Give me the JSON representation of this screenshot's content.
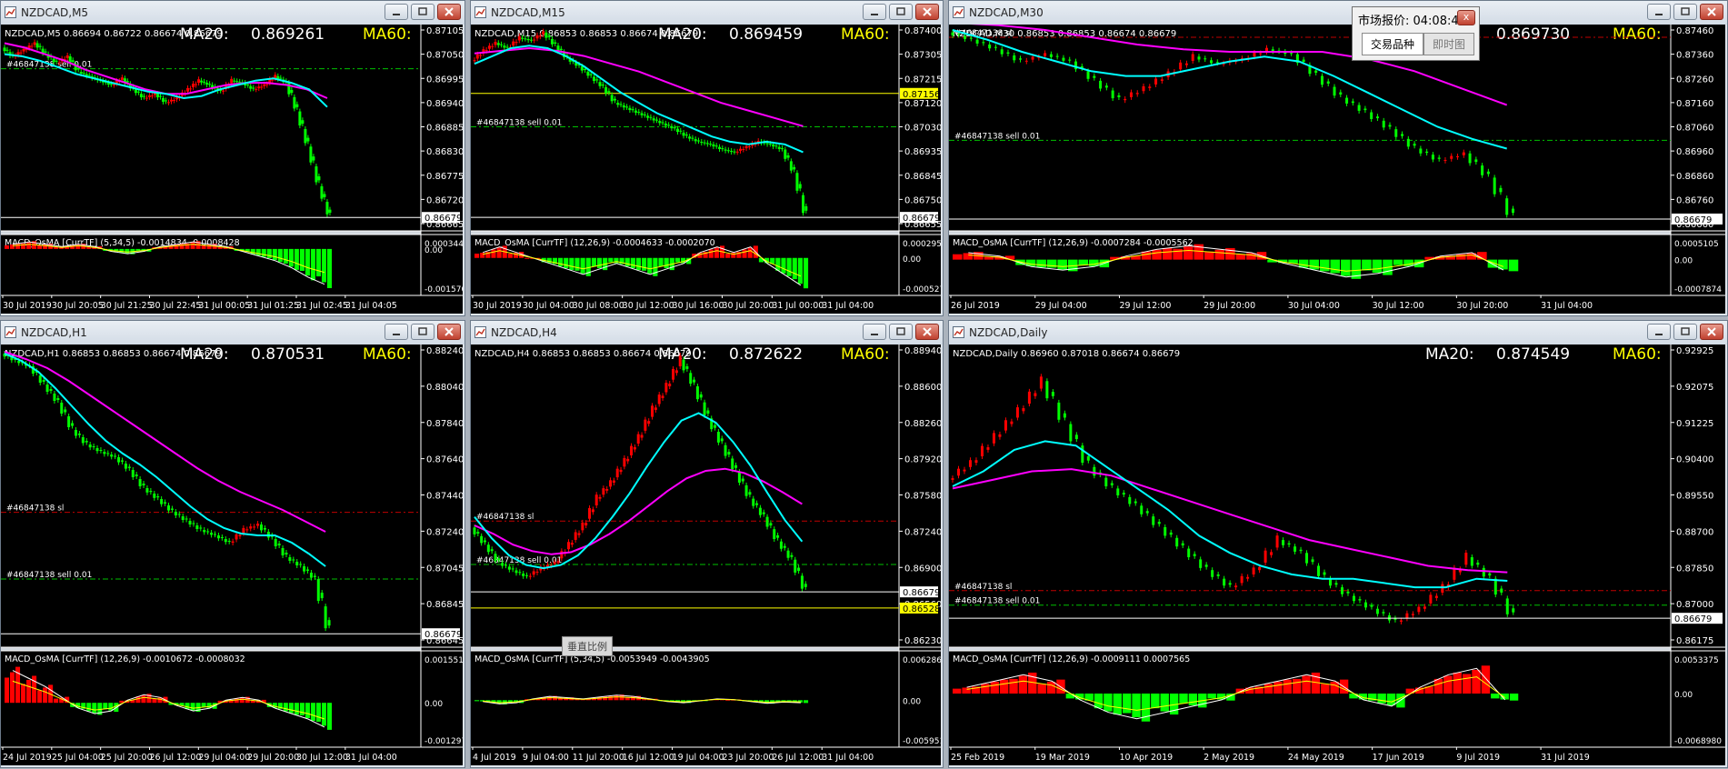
{
  "colors": {
    "up_candle": "#ff0000",
    "down_candle": "#00ff00",
    "ma20_line": "#00ffff",
    "ma60_line": "#ff00ff",
    "ma20_label": "#ffffff",
    "ma60_label": "#ffff00",
    "sell_line": "#00c000",
    "sl_line": "#c00000",
    "bid_line": "#ffffff",
    "ask_line": "#ffff00",
    "chart_bg": "#000000"
  },
  "icons": {
    "window": "chart-window-icon",
    "minimize": "minimize-icon",
    "restore": "restore-icon",
    "close": "close-icon"
  },
  "windows": [
    {
      "title": "NZDCAD,M5",
      "info": "NZDCAD,M5  0.86694 0.86722 0.86674 0.86679",
      "ma20_label": "MA20:",
      "ma20_value": "0.869261",
      "ma60_label": "MA60:",
      "price_labels": [
        "0.87105",
        "0.87050",
        "0.86995",
        "0.86940",
        "0.86885",
        "0.86830",
        "0.86775",
        "0.86720",
        "0.86665"
      ],
      "current_price": "0.86679",
      "marker_label": "",
      "orders": [
        {
          "text": "#46847138 sell 0.01",
          "type": "sell"
        }
      ],
      "macd_header": "MACD_OsMA [CurrTF] (5,34,5) -0.0014834 -0.0008428",
      "macd_axis": [
        "0.0003441",
        "0.00",
        "-0.0015704"
      ],
      "time_labels": [
        "30 Jul 2019",
        "30 Jul 20:05",
        "30 Jul 21:25",
        "30 Jul 22:45",
        "31 Jul 00:05",
        "31 Jul 01:25",
        "31 Jul 02:45",
        "31 Jul 04:05"
      ],
      "price_series": [
        0.87065,
        0.87045,
        0.8706,
        0.87075,
        0.8705,
        0.8703,
        0.87045,
        0.8701,
        0.87,
        0.8699,
        0.8698,
        0.86995,
        0.8697,
        0.8695,
        0.8696,
        0.8694,
        0.8695,
        0.8697,
        0.8699,
        0.8698,
        0.86965,
        0.8699,
        0.86985,
        0.8697,
        0.8698,
        0.87,
        0.86985,
        0.8692,
        0.8684,
        0.8675,
        0.86679
      ],
      "ma20_series": [
        0.8705,
        0.87045,
        0.87035,
        0.8702,
        0.87005,
        0.86995,
        0.86985,
        0.86975,
        0.86965,
        0.8696,
        0.8695,
        0.86955,
        0.8697,
        0.8698,
        0.8699,
        0.86995,
        0.86985,
        0.8697,
        0.8693
      ],
      "ma60_series": [
        0.87075,
        0.87065,
        0.8705,
        0.87035,
        0.87015,
        0.87,
        0.86985,
        0.8697,
        0.8696,
        0.8696,
        0.8697,
        0.8698,
        0.86985,
        0.86985,
        0.8698,
        0.8697,
        0.8695
      ],
      "macd_hist": [
        0.0002,
        0.0003,
        0.0002,
        0.0001,
        0.0002,
        0.0001,
        -0.0001,
        -0.0002,
        -0.0001,
        0.0001,
        0.0002,
        0.0003,
        0.0002,
        0.0001,
        -0.0001,
        -0.0003,
        -0.0005,
        -0.0008,
        -0.0012,
        -0.0015
      ]
    },
    {
      "title": "NZDCAD,M15",
      "info": "NZDCAD,M15  0.86853 0.86853 0.86674 0.86679",
      "ma20_label": "MA20:",
      "ma20_value": "0.869459",
      "ma60_label": "MA60:",
      "price_labels": [
        "0.87400",
        "0.87305",
        "0.87215",
        "0.87120",
        "0.87030",
        "0.86935",
        "0.86845",
        "0.86750",
        "0.86655"
      ],
      "current_price": "0.86679",
      "marker_label": "0.87156",
      "orders": [
        {
          "text": "#46847138 sell 0.01",
          "type": "sell"
        }
      ],
      "macd_header": "MACD_OsMA [CurrTF] (12,26,9) -0.0004633 -0.0002070",
      "macd_axis": [
        "0.0002953",
        "0.00",
        "-0.0005270"
      ],
      "time_labels": [
        "30 Jul 2019",
        "30 Jul 04:00",
        "30 Jul 08:00",
        "30 Jul 12:00",
        "30 Jul 16:00",
        "30 Jul 20:00",
        "31 Jul 00:00",
        "31 Jul 04:00"
      ],
      "price_series": [
        0.8728,
        0.8732,
        0.8735,
        0.8733,
        0.8737,
        0.8736,
        0.8739,
        0.8734,
        0.8729,
        0.8726,
        0.8722,
        0.8718,
        0.8712,
        0.871,
        0.8708,
        0.8706,
        0.8704,
        0.8702,
        0.8699,
        0.8697,
        0.8696,
        0.8694,
        0.8693,
        0.8695,
        0.8697,
        0.8696,
        0.8694,
        0.8685,
        0.86679
      ],
      "ma20_series": [
        0.8727,
        0.873,
        0.8733,
        0.8734,
        0.8733,
        0.873,
        0.8726,
        0.8721,
        0.8716,
        0.8712,
        0.8708,
        0.8705,
        0.8702,
        0.8699,
        0.8697,
        0.8696,
        0.8697,
        0.8696,
        0.8693
      ],
      "ma60_series": [
        0.8731,
        0.8732,
        0.8733,
        0.8732,
        0.873,
        0.8727,
        0.8724,
        0.872,
        0.8716,
        0.8712,
        0.8709,
        0.8706,
        0.8703
      ],
      "macd_hist": [
        0.0001,
        0.0002,
        0.0001,
        0.0,
        -0.0001,
        -0.0002,
        -0.0003,
        -0.0002,
        -0.0001,
        -0.0002,
        -0.0003,
        -0.0002,
        -0.0001,
        0.0001,
        0.0002,
        0.0001,
        0.0002,
        -0.0001,
        -0.0003,
        -0.0005
      ]
    },
    {
      "title": "NZDCAD,M30",
      "info": "NZDCAD,M30  0.86853 0.86853 0.86674 0.86679",
      "ma20_label": "MA20:",
      "ma20_value": "0.869730",
      "ma60_label": "MA60:",
      "price_labels": [
        "0.87460",
        "0.87360",
        "0.87260",
        "0.87160",
        "0.87060",
        "0.86960",
        "0.86860",
        "0.86760",
        "0.86660"
      ],
      "current_price": "0.86679",
      "marker_label": "",
      "orders": [
        {
          "text": "#46847138 sl",
          "type": "sl"
        },
        {
          "text": "#46847138 sell 0.01",
          "type": "sell"
        }
      ],
      "macd_header": "MACD_OsMA [CurrTF] (12,26,9) -0.0007284 -0.0005562",
      "macd_axis": [
        "0.0005105",
        "0.00",
        "-0.0007874"
      ],
      "time_labels": [
        "26 Jul 2019",
        "29 Jul 04:00",
        "29 Jul 12:00",
        "29 Jul 20:00",
        "30 Jul 04:00",
        "30 Jul 12:00",
        "30 Jul 20:00",
        "31 Jul 04:00"
      ],
      "price_series": [
        0.8745,
        0.8742,
        0.8738,
        0.8733,
        0.8736,
        0.8733,
        0.8725,
        0.8717,
        0.8722,
        0.8728,
        0.8735,
        0.8732,
        0.8734,
        0.8738,
        0.8736,
        0.8727,
        0.8718,
        0.8712,
        0.8705,
        0.8697,
        0.8692,
        0.8695,
        0.8685,
        0.86679
      ],
      "ma20_series": [
        0.8746,
        0.8742,
        0.8737,
        0.8733,
        0.8729,
        0.8727,
        0.8727,
        0.873,
        0.8733,
        0.8735,
        0.8733,
        0.8727,
        0.872,
        0.8713,
        0.8706,
        0.8701,
        0.8697
      ],
      "ma60_series": [
        0.8749,
        0.8748,
        0.8746,
        0.8743,
        0.874,
        0.8738,
        0.8737,
        0.8737,
        0.8737,
        0.8734,
        0.8729,
        0.8722,
        0.8715
      ],
      "macd_hist": [
        0.0002,
        0.0001,
        -0.0002,
        -0.0003,
        -0.0002,
        0.0001,
        0.0003,
        0.0004,
        0.0003,
        0.0002,
        -0.0001,
        -0.0003,
        -0.0005,
        -0.0004,
        -0.0002,
        0.0001,
        0.0002,
        -0.0003
      ]
    },
    {
      "title": "NZDCAD,H1",
      "info": "NZDCAD,H1  0.86853 0.86853 0.86674 0.86679",
      "ma20_label": "MA20:",
      "ma20_value": "0.870531",
      "ma60_label": "MA60:",
      "price_labels": [
        "0.88240",
        "0.88040",
        "0.87840",
        "0.87640",
        "0.87440",
        "0.87240",
        "0.87045",
        "0.86845",
        "0.86645"
      ],
      "current_price": "0.86679",
      "marker_label": "",
      "orders": [
        {
          "text": "#46847138 sl",
          "type": "sl"
        },
        {
          "text": "#46847138 sell 0.01",
          "type": "sell"
        }
      ],
      "macd_header": "MACD_OsMA [CurrTF] (12,26,9) -0.0010672 -0.0008032",
      "macd_axis": [
        "0.0015514",
        "0.00",
        "-0.0012972"
      ],
      "time_labels": [
        "24 Jul 2019",
        "25 Jul 04:00",
        "25 Jul 20:00",
        "26 Jul 12:00",
        "29 Jul 04:00",
        "29 Jul 20:00",
        "30 Jul 12:00",
        "31 Jul 04:00"
      ],
      "price_series": [
        0.8822,
        0.8818,
        0.8815,
        0.8805,
        0.8795,
        0.878,
        0.8772,
        0.8768,
        0.8765,
        0.8758,
        0.8748,
        0.8742,
        0.8735,
        0.873,
        0.8725,
        0.8722,
        0.8718,
        0.8725,
        0.8728,
        0.872,
        0.871,
        0.8705,
        0.8698,
        0.86679
      ],
      "ma20_series": [
        0.8822,
        0.8818,
        0.8812,
        0.8803,
        0.8793,
        0.8783,
        0.8774,
        0.8767,
        0.8761,
        0.8754,
        0.8746,
        0.8738,
        0.8731,
        0.8726,
        0.8723,
        0.8722,
        0.8722,
        0.8718,
        0.8712,
        0.8705
      ],
      "ma60_series": [
        0.8823,
        0.8819,
        0.8814,
        0.8807,
        0.8799,
        0.8791,
        0.8783,
        0.8775,
        0.8767,
        0.8759,
        0.8752,
        0.8746,
        0.8741,
        0.8736,
        0.873,
        0.8724
      ],
      "macd_hist": [
        0.0012,
        0.0009,
        0.0006,
        0.0002,
        -0.0002,
        -0.0004,
        -0.0003,
        0.0001,
        0.0003,
        0.0002,
        -0.0001,
        -0.0003,
        -0.0002,
        0.0001,
        0.0002,
        0.0001,
        -0.0002,
        -0.0004,
        -0.0006,
        -0.0009
      ]
    },
    {
      "title": "NZDCAD,H4",
      "info": "NZDCAD,H4  0.86853 0.86853 0.86674 0.86679",
      "ma20_label": "MA20:",
      "ma20_value": "0.872622",
      "ma60_label": "MA60:",
      "price_labels": [
        "0.88940",
        "0.88600",
        "0.88260",
        "0.87920",
        "0.87580",
        "0.87240",
        "0.86900",
        "0.86560",
        "0.86230"
      ],
      "current_price": "0.86679",
      "marker_label": "0.86528",
      "orders": [
        {
          "text": "#46847138 sl",
          "type": "sl"
        },
        {
          "text": "#46847138 sell 0.01",
          "type": "sell"
        }
      ],
      "macd_header": "MACD_OsMA [CurrTF] (5,34,5) -0.0053949 -0.0043905",
      "macd_axis": [
        "0.0062864",
        "0.00",
        "-0.0059510"
      ],
      "time_labels": [
        "4 Jul 2019",
        "9 Jul 04:00",
        "11 Jul 20:00",
        "16 Jul 12:00",
        "19 Jul 04:00",
        "23 Jul 20:00",
        "26 Jul 12:00",
        "31 Jul 04:00"
      ],
      "price_series": [
        0.8728,
        0.8712,
        0.8695,
        0.8688,
        0.8682,
        0.869,
        0.8695,
        0.8712,
        0.873,
        0.8755,
        0.877,
        0.879,
        0.8812,
        0.8838,
        0.886,
        0.8885,
        0.886,
        0.883,
        0.8805,
        0.878,
        0.8755,
        0.8738,
        0.8715,
        0.8698,
        0.86679
      ],
      "ma20_series": [
        0.8738,
        0.8718,
        0.8702,
        0.8693,
        0.869,
        0.8693,
        0.8702,
        0.8718,
        0.8738,
        0.876,
        0.8785,
        0.8808,
        0.8828,
        0.8835,
        0.8826,
        0.8808,
        0.8786,
        0.876,
        0.8735,
        0.8715
      ],
      "ma60_series": [
        0.873,
        0.8722,
        0.8712,
        0.8706,
        0.8703,
        0.8705,
        0.8712,
        0.8722,
        0.8734,
        0.8748,
        0.8762,
        0.8774,
        0.8781,
        0.8783,
        0.8779,
        0.8771,
        0.8761,
        0.875
      ],
      "macd_hist": [
        -0.0002,
        -0.0006,
        -0.0004,
        0.0002,
        0.0006,
        0.0004,
        0.0002,
        0.0005,
        0.0008,
        0.0006,
        0.0002,
        -0.0002,
        -0.0004,
        -0.0001,
        0.0002,
        0.0001,
        -0.0002,
        -0.0005,
        -0.0003,
        -0.0004
      ]
    },
    {
      "title": "NZDCAD,Daily",
      "info": "NZDCAD,Daily  0.86960 0.87018 0.86674 0.86679",
      "ma20_label": "MA20:",
      "ma20_value": "0.874549",
      "ma60_label": "MA60:",
      "price_labels": [
        "0.92925",
        "0.92075",
        "0.91225",
        "0.90400",
        "0.89550",
        "0.88700",
        "0.87850",
        "0.87000",
        "0.86175"
      ],
      "current_price": "0.86679",
      "marker_label": "",
      "orders": [
        {
          "text": "#46847138 sl",
          "type": "sl"
        },
        {
          "text": "#46847138 sell 0.01",
          "type": "sell"
        }
      ],
      "macd_header": "MACD_OsMA [CurrTF] (12,26,9) -0.0009111 0.0007565",
      "macd_axis": [
        "0.0053375",
        "0.00",
        "-0.0068980"
      ],
      "time_labels": [
        "25 Feb 2019",
        "19 Mar 2019",
        "10 Apr 2019",
        "2 May 2019",
        "24 May 2019",
        "17 Jun 2019",
        "9 Jul 2019",
        "31 Jul 2019"
      ],
      "price_series": [
        0.899,
        0.903,
        0.909,
        0.915,
        0.922,
        0.912,
        0.902,
        0.897,
        0.893,
        0.888,
        0.883,
        0.878,
        0.874,
        0.878,
        0.885,
        0.882,
        0.876,
        0.872,
        0.869,
        0.866,
        0.869,
        0.874,
        0.881,
        0.876,
        0.86679
      ],
      "ma20_series": [
        0.8975,
        0.901,
        0.906,
        0.908,
        0.907,
        0.902,
        0.897,
        0.892,
        0.886,
        0.882,
        0.879,
        0.877,
        0.876,
        0.876,
        0.875,
        0.874,
        0.874,
        0.876,
        0.8755
      ],
      "ma60_series": [
        0.897,
        0.899,
        0.901,
        0.9015,
        0.9,
        0.897,
        0.894,
        0.891,
        0.888,
        0.885,
        0.883,
        0.881,
        0.879,
        0.878,
        0.8775
      ],
      "macd_hist": [
        0.001,
        0.002,
        0.003,
        0.002,
        -0.001,
        -0.003,
        -0.004,
        -0.003,
        -0.002,
        -0.001,
        0.001,
        0.002,
        0.003,
        0.002,
        -0.001,
        -0.002,
        0.001,
        0.003,
        0.004,
        -0.001
      ]
    }
  ],
  "market_popup": {
    "title": "市场报价: 04:08:45",
    "close": "x",
    "tabs": [
      "交易品种",
      "即时图"
    ]
  },
  "tooltip": "垂直比例"
}
